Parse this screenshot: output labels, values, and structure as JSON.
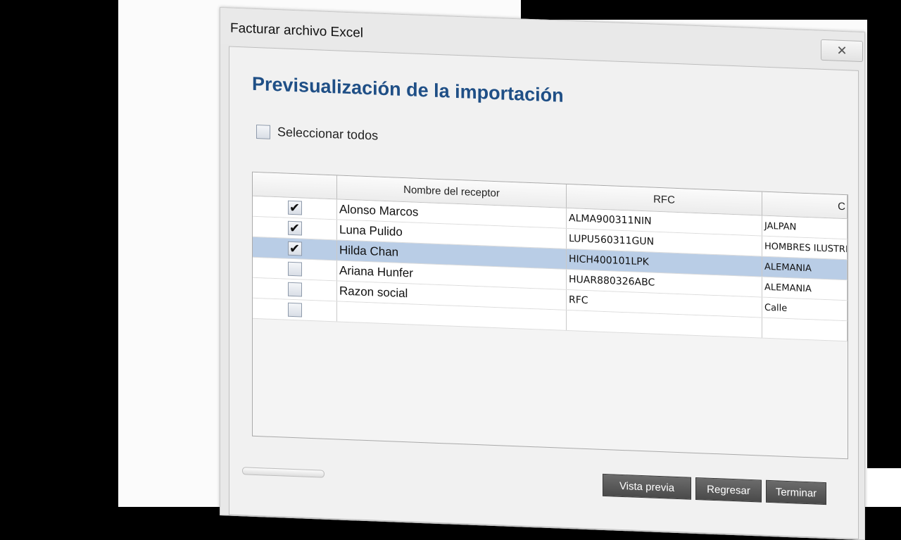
{
  "window": {
    "title": "Facturar archivo Excel",
    "close_glyph": "✕"
  },
  "page": {
    "heading": "Previsualización de la importación",
    "select_all_label": "Seleccionar todos",
    "select_all_checked": false
  },
  "table": {
    "columns": [
      "",
      "Nombre del receptor",
      "RFC",
      "C"
    ],
    "rows": [
      {
        "checked": true,
        "name": "Alonso Marcos",
        "rfc": "ALMA900311NIN",
        "col3": "JALPAN",
        "selected": false
      },
      {
        "checked": true,
        "name": "Luna Pulido",
        "rfc": "LUPU560311GUN",
        "col3": "HOMBRES ILUSTRE",
        "selected": false
      },
      {
        "checked": true,
        "name": "Hilda Chan",
        "rfc": "HICH400101LPK",
        "col3": "ALEMANIA",
        "selected": true
      },
      {
        "checked": false,
        "name": "Ariana Hunfer",
        "rfc": "HUAR880326ABC",
        "col3": "ALEMANIA",
        "selected": false
      },
      {
        "checked": false,
        "name": "Razon social",
        "rfc": "RFC",
        "col3": "Calle",
        "selected": false
      },
      {
        "checked": false,
        "name": "",
        "rfc": "",
        "col3": "",
        "selected": false
      }
    ]
  },
  "buttons": {
    "preview": "Vista previa",
    "back": "Regresar",
    "finish": "Terminar"
  },
  "icons": {
    "close": "close-icon",
    "check": "check-icon"
  },
  "colors": {
    "heading": "#1f4f86",
    "selected_row": "#b9cde6",
    "button": "#555555"
  }
}
